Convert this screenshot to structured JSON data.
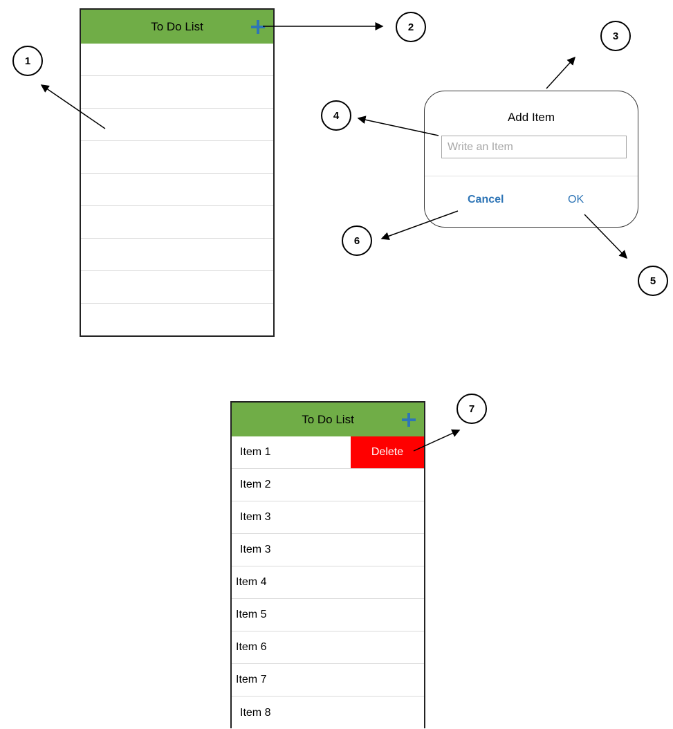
{
  "top_screen": {
    "title": "To Do List",
    "plus_icon": "plus-icon",
    "rows": [
      "",
      "",
      "",
      "",
      "",
      "",
      "",
      "",
      ""
    ]
  },
  "dialog": {
    "title": "Add Item",
    "input_placeholder": "Write an Item",
    "input_value": "",
    "cancel_label": "Cancel",
    "ok_label": "OK"
  },
  "bottom_screen": {
    "title": "To Do List",
    "plus_icon": "plus-icon",
    "items": [
      "Item 1",
      "Item 2",
      "Item 3",
      "Item 3",
      "Item 4",
      "Item 5",
      "Item 6",
      "Item 7",
      "Item 8"
    ],
    "delete_label": "Delete"
  },
  "callouts": [
    "1",
    "2",
    "3",
    "4",
    "5",
    "6",
    "7"
  ],
  "colors": {
    "nav_bar": "#70ad47",
    "accent_blue": "#2e75b6",
    "delete_red": "#ff0000"
  }
}
